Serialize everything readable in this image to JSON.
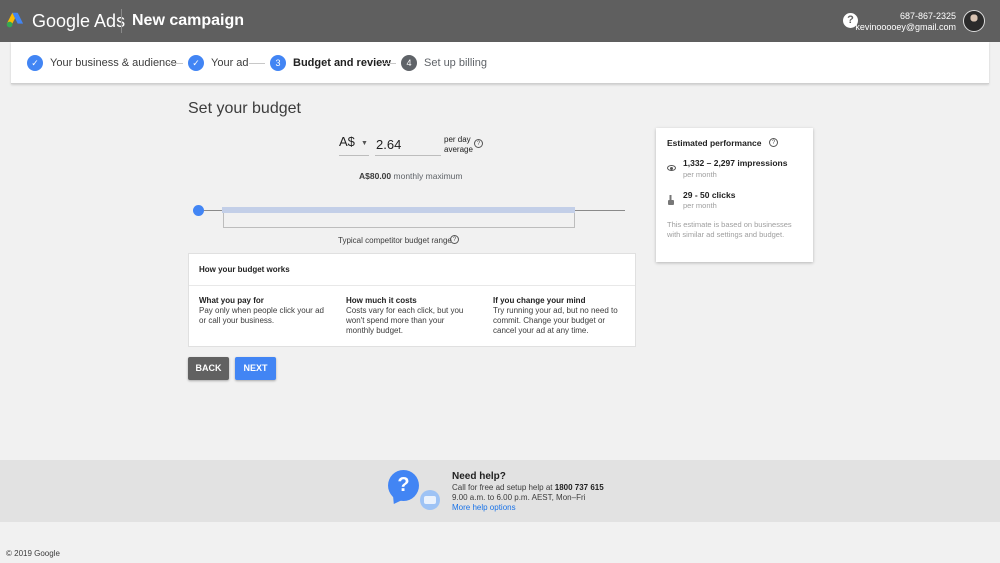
{
  "header": {
    "brand": "Google Ads",
    "campaign_title": "New campaign",
    "phone": "687-867-2325",
    "email": "kevinooooey@gmail.com",
    "help_glyph": "?"
  },
  "stepper": {
    "steps": [
      {
        "label": "Your business & audience",
        "state": "done",
        "marker": "✓"
      },
      {
        "label": "Your ad",
        "state": "done",
        "marker": "✓"
      },
      {
        "label": "Budget and review",
        "state": "current",
        "marker": "3"
      },
      {
        "label": "Set up billing",
        "state": "todo",
        "marker": "4"
      }
    ]
  },
  "budget": {
    "title": "Set your budget",
    "currency": "A$",
    "daily_value": "2.64",
    "per_day_label_1": "per day",
    "per_day_label_2": "average",
    "monthly_amount": "A$80.00",
    "monthly_label": "monthly maximum",
    "competitor_label": "Typical competitor budget range",
    "slider_position": 0.0
  },
  "works": {
    "title": "How your budget works",
    "columns": [
      {
        "heading": "What you pay for",
        "body": "Pay only when people click your ad or call your business."
      },
      {
        "heading": "How much it costs",
        "body": "Costs vary for each click, but you won't spend more than your monthly budget."
      },
      {
        "heading": "If you change your mind",
        "body": "Try running your ad, but no need to commit. Change your budget or cancel your ad at any time."
      }
    ]
  },
  "buttons": {
    "back": "BACK",
    "next": "NEXT"
  },
  "performance": {
    "title": "Estimated performance",
    "impressions": "1,332 – 2,297 impressions",
    "impressions_period": "per month",
    "clicks": "29 - 50 clicks",
    "clicks_period": "per month",
    "note": "This estimate is based on businesses with similar ad settings and budget."
  },
  "help": {
    "title": "Need help?",
    "line1_prefix": "Call for free ad setup help at",
    "line1_number": "1800 737 615",
    "line2": "9.00 a.m. to 6.00 p.m. AEST, Mon–Fri",
    "link": "More help options"
  },
  "footer": {
    "copyright": "© 2019 Google"
  },
  "colors": {
    "accent": "#4285f4",
    "header_bg": "#5f5f5f",
    "page_bg": "#f1f1f1"
  }
}
